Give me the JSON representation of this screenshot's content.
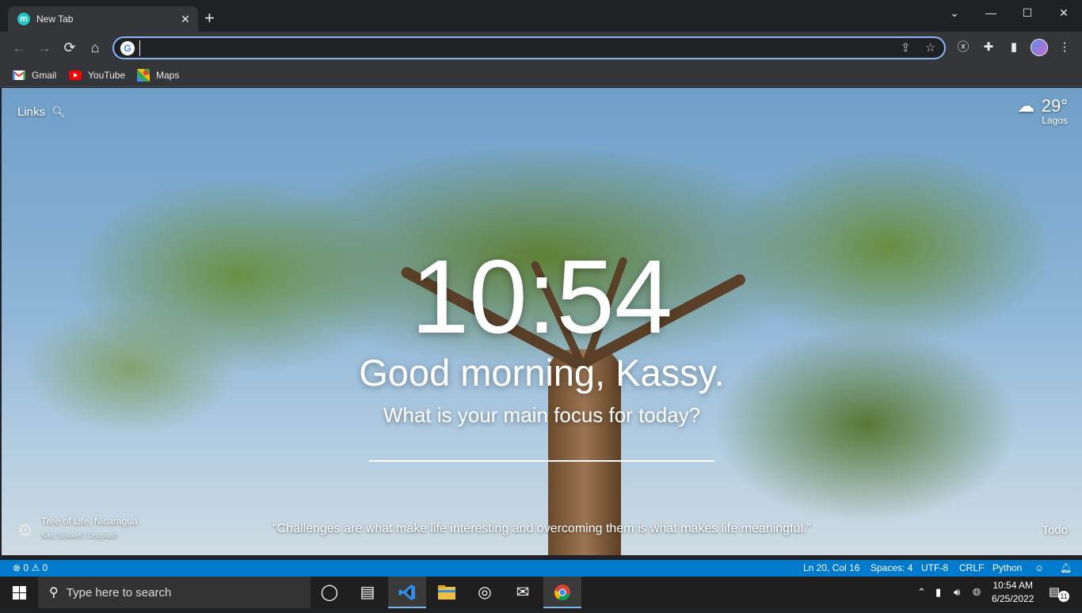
{
  "browser": {
    "tab": {
      "title": "New Tab",
      "favicon_letter": "m",
      "close": "✕"
    },
    "new_tab": "+",
    "window": {
      "minimize": "—",
      "maximize": "☐",
      "close": "✕",
      "tab_search": "⌄"
    },
    "nav": {
      "back": "←",
      "forward": "→",
      "reload": "⟳",
      "home": "⌂"
    },
    "omnibox": {
      "value": "",
      "placeholder": "",
      "google_letter": "G",
      "share_icon": "⇪",
      "star_icon": "☆"
    },
    "toolbar_icons": {
      "extension_x": "ⓧ",
      "extensions": "✚",
      "side_panel": "▮",
      "menu": "⋮"
    },
    "bookmarks": [
      {
        "label": "Gmail",
        "icon": "gmail-icon"
      },
      {
        "label": "YouTube",
        "icon": "youtube-icon"
      },
      {
        "label": "Maps",
        "icon": "maps-icon"
      }
    ]
  },
  "momentum": {
    "links": "Links",
    "weather": {
      "temp": "29°",
      "location": "Lagos",
      "icon": "partly-cloudy-icon"
    },
    "clock": "10:54",
    "greeting": "Good morning, Kassy.",
    "focus_question": "What is your main focus for today?",
    "focus_value": "",
    "photo": {
      "location": "Tree of Life, Nicaragua",
      "credit": "Niko Soikkeli / Unsplash"
    },
    "quote": "“Challenges are what make life interesting and overcoming them is what makes life meaningful.”",
    "todo": "Todo"
  },
  "statusbar": {
    "errors": "0",
    "warnings": "0",
    "position": "Ln 20, Col 16",
    "spaces": "Spaces: 4",
    "encoding": "UTF-8",
    "eol": "CRLF",
    "language": "Python"
  },
  "taskbar": {
    "search_placeholder": "Type here to search",
    "time": "10:54 AM",
    "date": "6/25/2022",
    "notification_count": "11"
  },
  "colors": {
    "accent": "#8ab4f8",
    "statusbar": "#007acc",
    "taskbar": "#1f1f1f",
    "chrome_toolbar": "#35363a"
  }
}
